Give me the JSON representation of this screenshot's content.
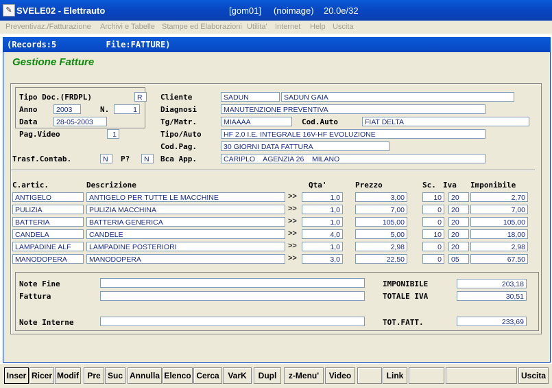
{
  "window": {
    "title": "SVELE02 - Elettrauto",
    "info": "[gom01]     (noimage)    20.0e/32",
    "icon": "app-icon"
  },
  "menu": [
    "Preventivaz./Fatturazione",
    "Archivi e Tabelle",
    "Stampe ed Elaborazioni",
    "Utilita'",
    "Internet",
    "Help",
    "Uscita"
  ],
  "child": {
    "title": "(Records:5          File:FATTURE)"
  },
  "form_title": "Gestione Fatture",
  "header": {
    "tipo_doc_label": "Tipo Doc.(FRDPL)",
    "tipo_doc": "R",
    "anno_label": "Anno",
    "anno": "2003",
    "n_label": "N.",
    "n": "1",
    "data_label": "Data",
    "data": "28-05-2003",
    "pagvideo_label": "Pag.Video",
    "pagvideo": "1",
    "trasf_label": "Trasf.Contab.",
    "trasf": "N",
    "p_label": "P?",
    "p": "N",
    "cliente_label": "Cliente",
    "cliente_code": "SADUN",
    "cliente_name": "SADUN  GAIA",
    "diagnosi_label": "Diagnosi",
    "diagnosi": "MANUTENZIONE PREVENTIVA",
    "tgmatr_label": "Tg/Matr.",
    "tgmatr": "MIAAAA",
    "codauto_label": "Cod.Auto",
    "codauto": "FIAT DELTA",
    "tipoauto_label": "Tipo/Auto",
    "tipoauto": "HF 2.0 I.E. INTEGRALE 16V-HF EVOLUZIONE",
    "codpag_label": "Cod.Pag.",
    "codpag": "30 GIORNI DATA FATTURA",
    "bca_label": "Bca App.",
    "bca": "CARIPLO    AGENZIA 26    MILANO"
  },
  "table": {
    "headers": {
      "code": "C.artic.",
      "desc": "Descrizione",
      "qty": "Qta'",
      "price": "Prezzo",
      "sc": "Sc.",
      "iva": "Iva",
      "imp": "Imponibile"
    },
    "arrow": ">>",
    "rows": [
      {
        "code": "ANTIGELO",
        "desc": "ANTIGELO PER TUTTE LE MACCHINE",
        "qty": "1,0",
        "price": "3,00",
        "sc": "10",
        "iva": "20",
        "imp": "2,70"
      },
      {
        "code": "PULIZIA",
        "desc": "PULIZIA MACCHINA",
        "qty": "1,0",
        "price": "7,00",
        "sc": "0",
        "iva": "20",
        "imp": "7,00"
      },
      {
        "code": "BATTERIA",
        "desc": "BATTERIA GENERICA",
        "qty": "1,0",
        "price": "105,00",
        "sc": "0",
        "iva": "20",
        "imp": "105,00"
      },
      {
        "code": "CANDELA",
        "desc": "CANDELE",
        "qty": "4,0",
        "price": "5,00",
        "sc": "10",
        "iva": "20",
        "imp": "18,00"
      },
      {
        "code": "LAMPADINE ALF",
        "desc": "LAMPADINE POSTERIORI",
        "qty": "1,0",
        "price": "2,98",
        "sc": "0",
        "iva": "20",
        "imp": "2,98"
      },
      {
        "code": "MANODOPERA",
        "desc": "MANODOPERA",
        "qty": "3,0",
        "price": "22,50",
        "sc": "0",
        "iva": "05",
        "imp": "67,50"
      }
    ]
  },
  "footer": {
    "note_fine_label": "Note Fine",
    "fattura_label": "Fattura",
    "note_interne_label": "Note Interne",
    "note_fine": "",
    "fattura": "",
    "note_interne": "",
    "imponibile_label": "IMPONIBILE",
    "imponibile": "203,18",
    "totale_iva_label": "TOTALE IVA",
    "totale_iva": "30,51",
    "tot_fatt_label": "TOT.FATT.",
    "tot_fatt": "233,69"
  },
  "buttons": [
    "Inser",
    "Ricer",
    "Modif",
    "Pre",
    "Suc",
    "Annulla",
    "Elenco",
    "Cerca",
    "VarK",
    "Dupl",
    "z-Menu'",
    "Video",
    "",
    "Link",
    "",
    "",
    "Uscita"
  ]
}
